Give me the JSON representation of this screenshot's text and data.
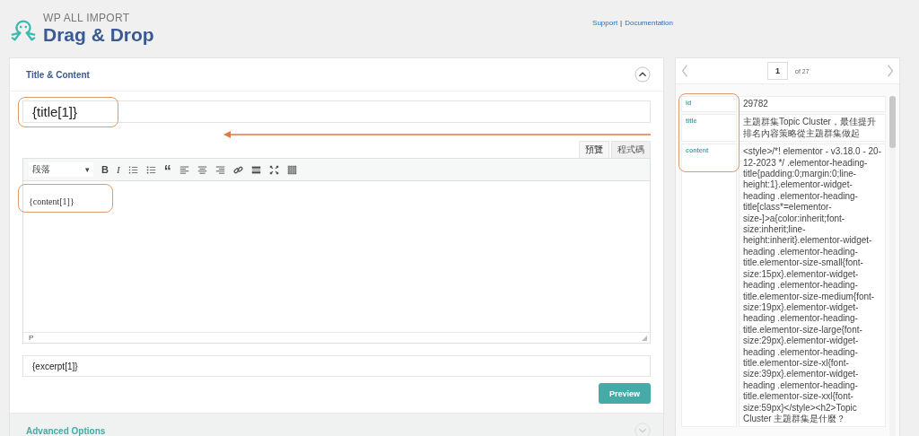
{
  "header": {
    "brand_top": "WP ALL IMPORT",
    "brand": "Drag & Drop",
    "links": [
      "Support",
      "Documentation"
    ],
    "separator": "|"
  },
  "panel": {
    "title": "Title & Content",
    "expanded": true,
    "title_field": {
      "value": "{title[1]}"
    },
    "editor_tabs": [
      {
        "label": "預覽",
        "selected": true
      },
      {
        "label": "程式碼",
        "selected": false
      }
    ],
    "format_select": "段落",
    "format_caret": "▾",
    "toolbar": [
      {
        "kind": "bold",
        "label": "B"
      },
      {
        "kind": "italic",
        "label": "I"
      },
      {
        "kind": "bullets"
      },
      {
        "kind": "numbers"
      },
      {
        "kind": "quote",
        "label": "“"
      },
      {
        "kind": "align-left"
      },
      {
        "kind": "align-center"
      },
      {
        "kind": "align-right"
      },
      {
        "kind": "link"
      },
      {
        "kind": "more"
      },
      {
        "kind": "fullscreen"
      },
      {
        "kind": "kitchen-sink"
      }
    ],
    "content": "{content[1]}",
    "path": "P",
    "excerpt": {
      "value": "{excerpt[1]}"
    },
    "preview_button": "Preview"
  },
  "advanced": {
    "title": "Advanced Options",
    "expanded": false
  },
  "pager": {
    "page": "1",
    "of": "of 27"
  },
  "record": [
    {
      "key": "id",
      "value": "29782"
    },
    {
      "key": "title",
      "value": "主題群集Topic Cluster，最佳提升排名內容策略從主題群集做起"
    },
    {
      "key": "content",
      "value": "<style>/*! elementor - v3.18.0 - 20-12-2023 */ .elementor-heading-title{padding:0;margin:0;line-height:1}.elementor-widget-heading .elementor-heading-title[class*=elementor-size-]>a{color:inherit;font-size:inherit;line-height:inherit}.elementor-widget-heading .elementor-heading-title.elementor-size-small{font-size:15px}.elementor-widget-heading .elementor-heading-title.elementor-size-medium{font-size:19px}.elementor-widget-heading .elementor-heading-title.elementor-size-large{font-size:29px}.elementor-widget-heading .elementor-heading-title.elementor-size-xl{font-size:39px}.elementor-widget-heading .elementor-heading-title.elementor-size-xxl{font-size:59px}</style><h2>Topic Cluster 主題群集是什麼？"
    }
  ]
}
